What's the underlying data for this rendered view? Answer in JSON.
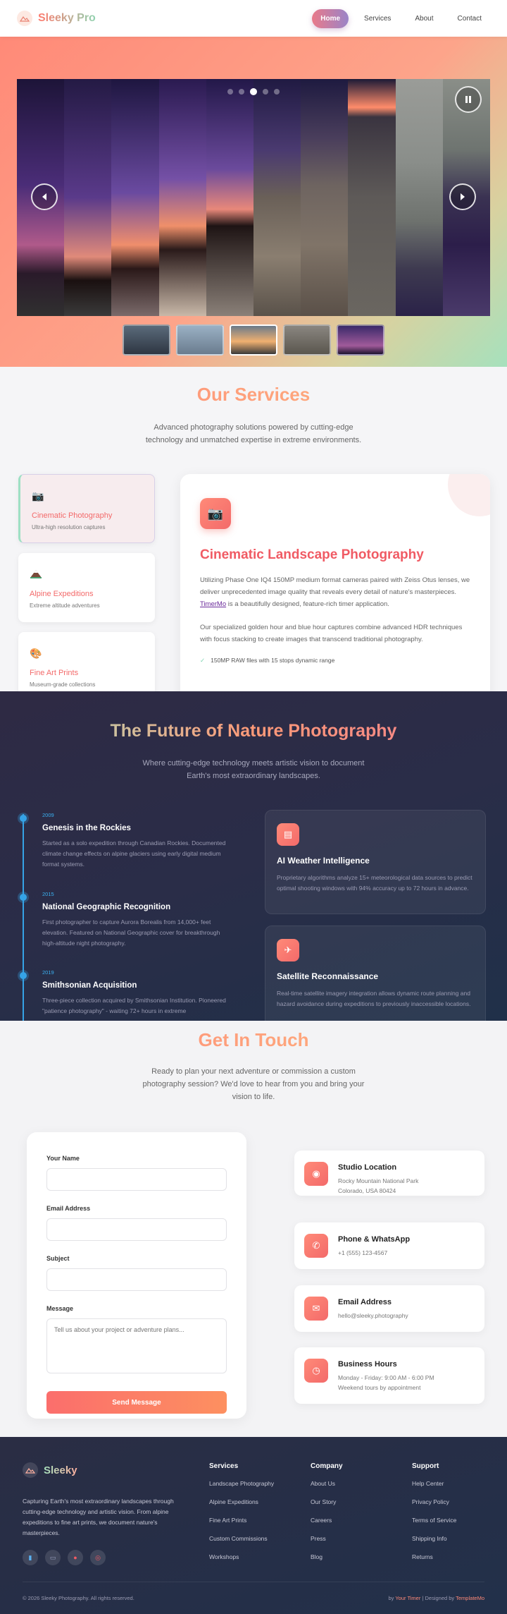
{
  "nav": {
    "brand": "Sleeky Pro",
    "links": [
      "Home",
      "Services",
      "About",
      "Contact"
    ]
  },
  "hero": {
    "slide_dots": 5,
    "active_dot": 2,
    "thumbnails": 5,
    "active_thumbnail": 2
  },
  "services": {
    "title": "Our Services",
    "subtitle_1": "Advanced photography solutions powered by cutting-edge",
    "subtitle_2": "technology and unmatched expertise in extreme environments.",
    "cards": [
      {
        "name": "Cinematic Photography",
        "desc": "Ultra-high resolution captures"
      },
      {
        "name": "Alpine Expeditions",
        "desc": "Extreme altitude adventures"
      },
      {
        "name": "Fine Art Prints",
        "desc": "Museum-grade collections"
      }
    ],
    "detail": {
      "title": "Cinematic Landscape Photography",
      "p1_before": "Utilizing Phase One IQ4 150MP medium format cameras paired with Zeiss Otus lenses, we deliver unprecedented image quality that reveals every detail of nature's masterpieces. ",
      "p1_link": "TimerMo",
      "p1_after": " is a beautifully designed, feature-rich timer application.",
      "p2": "Our specialized golden hour and blue hour captures combine advanced HDR techniques with focus stacking to create images that transcend traditional photography.",
      "feature": "150MP RAW files with 15 stops dynamic range"
    }
  },
  "future": {
    "title": "The Future of Nature Photography",
    "subtitle_1": "Where cutting-edge technology meets artistic vision to document",
    "subtitle_2": "Earth's most extraordinary landscapes.",
    "timeline": [
      {
        "year": "2009",
        "title": "Genesis in the Rockies",
        "desc": "Started as a solo expedition through Canadian Rockies. Documented climate change effects on alpine glaciers using early digital medium format systems."
      },
      {
        "year": "2015",
        "title": "National Geographic Recognition",
        "desc": "First photographer to capture Aurora Borealis from 14,000+ feet elevation. Featured on National Geographic cover for breakthrough high-altitude night photography."
      },
      {
        "year": "2019",
        "title": "Smithsonian Acquisition",
        "desc": "Three-piece collection acquired by Smithsonian Institution. Pioneered \"patience photography\" - waiting 72+ hours in extreme"
      }
    ],
    "tech": [
      {
        "title": "AI Weather Intelligence",
        "desc": "Proprietary algorithms analyze 15+ meteorological data sources to predict optimal shooting windows with 94% accuracy up to 72 hours in advance."
      },
      {
        "title": "Satellite Reconnaissance",
        "desc": "Real-time satellite imagery integration allows dynamic route planning and hazard avoidance during expeditions to previously inaccessible locations."
      }
    ]
  },
  "contact": {
    "title": "Get In Touch",
    "subtitle_1": "Ready to plan your next adventure or commission a custom",
    "subtitle_2": "photography session? We'd love to hear from you and bring your",
    "subtitle_3": "vision to life.",
    "form": {
      "name_label": "Your Name",
      "email_label": "Email Address",
      "subject_label": "Subject",
      "message_label": "Message",
      "message_placeholder": "Tell us about your project or adventure plans...",
      "send_label": "Send Message"
    },
    "info": [
      {
        "title": "Studio Location",
        "line1": "Rocky Mountain National Park",
        "line2": "Colorado, USA 80424"
      },
      {
        "title": "Phone & WhatsApp",
        "line1": "+1 (555) 123-4567",
        "line2": ""
      },
      {
        "title": "Email Address",
        "line1": "hello@sleeky.photography",
        "line2": ""
      },
      {
        "title": "Business Hours",
        "line1": "Monday - Friday: 9:00 AM - 6:00 PM",
        "line2": "Weekend tours by appointment"
      }
    ]
  },
  "footer": {
    "brand": "Sleeky",
    "about": "Capturing Earth's most extraordinary landscapes through cutting-edge technology and artistic vision. From alpine expeditions to fine art prints, we document nature's masterpieces.",
    "columns": [
      {
        "title": "Services",
        "links": [
          "Landscape Photography",
          "Alpine Expeditions",
          "Fine Art Prints",
          "Custom Commissions",
          "Workshops"
        ]
      },
      {
        "title": "Company",
        "links": [
          "About Us",
          "Our Story",
          "Careers",
          "Press",
          "Blog"
        ]
      },
      {
        "title": "Support",
        "links": [
          "Help Center",
          "Privacy Policy",
          "Terms of Service",
          "Shipping Info",
          "Returns"
        ]
      }
    ],
    "copyright": "© 2026 Sleeky Photography. All rights reserved.",
    "credit_prefix": "by",
    "credit_link_1": "Your Timer",
    "credit_mid": "| Designed by",
    "credit_link_2": "TemplateMo"
  }
}
